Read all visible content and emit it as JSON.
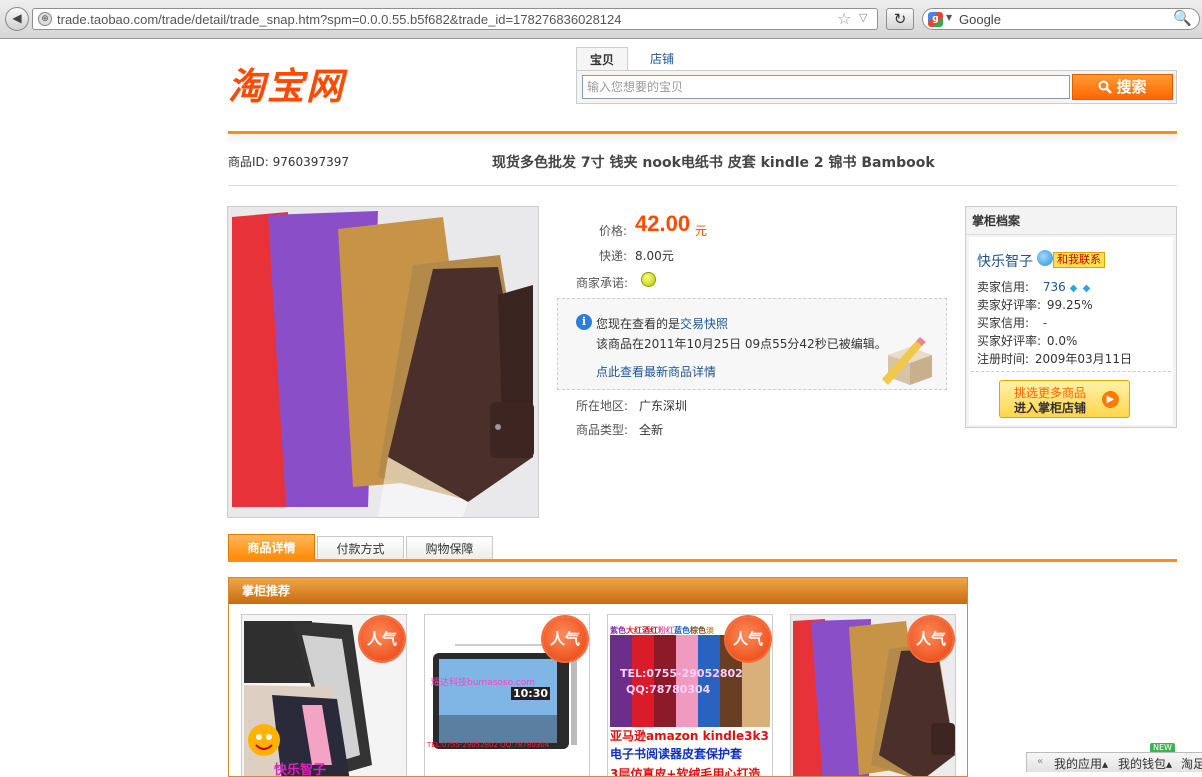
{
  "browser": {
    "back_glyph": "◀",
    "url": "trade.taobao.com/trade/detail/trade_snap.htm?spm=0.0.0.55.b5f682&trade_id=178276836028124",
    "reload_glyph": "↻",
    "search_engine": "Google",
    "search_logo": "g",
    "star_glyph": "☆",
    "dropdown_glyph": "▽",
    "magnifier_glyph": "🔍"
  },
  "header": {
    "logo": "淘宝网",
    "search_tabs": [
      "宝贝",
      "店铺"
    ],
    "search_placeholder": "输入您想要的宝贝",
    "search_button": "搜索",
    "search_icon": "magnifier-icon"
  },
  "item": {
    "id_label": "商品ID: 9760397397",
    "title": "现货多色批发 7寸 钱夹 nook电纸书 皮套 kindle 2 锦书 Bambook",
    "price_label": "价格:",
    "price": "42.00",
    "price_unit": "元",
    "shipping_label": "快递:",
    "shipping_value": "8.00元",
    "promise_label": "商家承诺:",
    "location_label": "所在地区:",
    "location_value": "广东深圳",
    "type_label": "商品类型:",
    "type_value": "全新"
  },
  "notice": {
    "line1_prefix": "您现在查看的是",
    "line1_link": "交易快照",
    "line2": "该商品在2011年10月25日 09点55分42秒已被编辑。",
    "link": "点此查看最新商品详情"
  },
  "keeper": {
    "title": "掌柜档案",
    "name": "快乐智子",
    "contact": "和我联系",
    "seller_credit_label": "卖家信用:",
    "seller_credit_value": "736",
    "seller_rate_label": "卖家好评率:",
    "seller_rate_value": "99.25%",
    "buyer_credit_label": "买家信用:",
    "buyer_credit_value": "-",
    "buyer_rate_label": "买家好评率:",
    "buyer_rate_value": "0.0%",
    "reg_label": "注册时间:",
    "reg_value": "2009年03月11日",
    "enter_line1": "挑选更多商品",
    "enter_line2": "进入掌柜店铺",
    "diamond_glyph": "◆",
    "arrow_glyph": "▶"
  },
  "tabs": [
    "商品详情",
    "付款方式",
    "购物保障"
  ],
  "recommend": {
    "title": "掌柜推荐",
    "badge": "人气",
    "card1_caption": "快乐智子",
    "card2_watermark": "耀达科技bumasoso.com",
    "card2_time": "10:30",
    "card2_tel": "TEL:0755-29052802 QQ:78780304",
    "card3_colors": [
      "紫色",
      "大红",
      "酒红",
      "粉红",
      "蓝色",
      "棕色",
      "淡"
    ],
    "card3_tel": "TEL:0755-29052802",
    "card3_qq": "QQ:78780304",
    "card3_line1": "亚马逊amazon kindle3k3",
    "card3_line2": "电子书阅读器皮套保护套",
    "card3_line3": "3层仿真皮+软绒毛用心打造"
  },
  "taskbar": {
    "new_tag": "NEW",
    "items": [
      "我的应用",
      "我的钱包",
      "淘足"
    ]
  }
}
